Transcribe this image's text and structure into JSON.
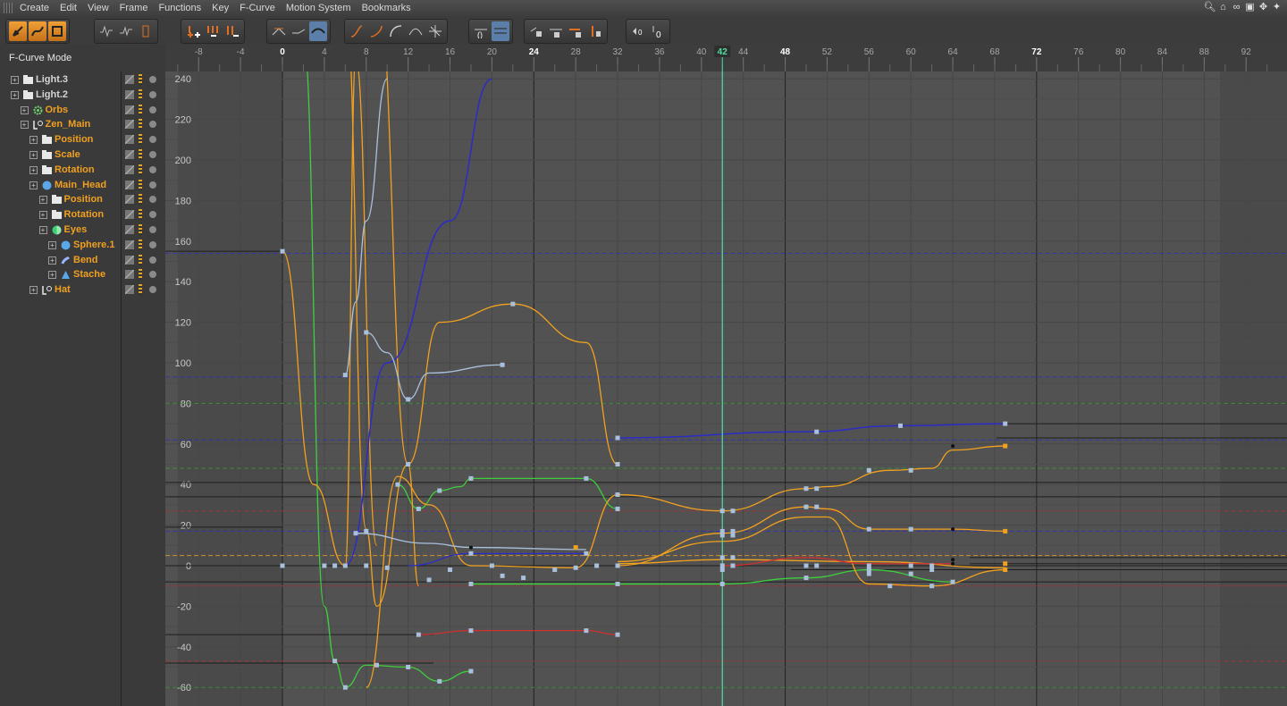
{
  "menubar": {
    "items": [
      "Create",
      "Edit",
      "View",
      "Frame",
      "Functions",
      "Key",
      "F-Curve",
      "Motion System",
      "Bookmarks"
    ]
  },
  "mode_label": "F-Curve Mode",
  "ruler": {
    "ticks": [
      "-8",
      "-4",
      "0",
      "4",
      "8",
      "12",
      "16",
      "20",
      "24",
      "28",
      "32",
      "36",
      "40",
      "44",
      "48",
      "52",
      "56",
      "60",
      "64",
      "68",
      "72",
      "76",
      "80",
      "84",
      "88",
      "92"
    ],
    "bold_ticks": [
      "0",
      "24",
      "48",
      "72"
    ],
    "current_frame": "42"
  },
  "y_axis": {
    "labels": [
      "240",
      "220",
      "200",
      "180",
      "160",
      "140",
      "120",
      "100",
      "80",
      "60",
      "40",
      "20",
      "0",
      "-20",
      "-40",
      "-60"
    ]
  },
  "tree": [
    {
      "label": "Light.3",
      "icon": "folder-icon",
      "level": 0,
      "color": "#d4d4d4"
    },
    {
      "label": "Light.2",
      "icon": "folder-icon",
      "level": 0,
      "color": "#d4d4d4"
    },
    {
      "label": "Orbs",
      "icon": "gear-icon",
      "level": 1,
      "color": "#f0a020"
    },
    {
      "label": "Zen_Main",
      "icon": "null-object-icon",
      "level": 1,
      "color": "#f0a020"
    },
    {
      "label": "Position",
      "icon": "folder-icon",
      "level": 2,
      "color": "#f0a020"
    },
    {
      "label": "Scale",
      "icon": "folder-icon",
      "level": 2,
      "color": "#f0a020"
    },
    {
      "label": "Rotation",
      "icon": "folder-icon",
      "level": 2,
      "color": "#f0a020"
    },
    {
      "label": "Main_Head",
      "icon": "sphere-icon",
      "level": 2,
      "color": "#f0a020"
    },
    {
      "label": "Position",
      "icon": "folder-icon",
      "level": 3,
      "color": "#f0a020"
    },
    {
      "label": "Rotation",
      "icon": "folder-icon",
      "level": 3,
      "color": "#f0a020"
    },
    {
      "label": "Eyes",
      "icon": "half-sphere-icon",
      "level": 3,
      "color": "#f0a020"
    },
    {
      "label": "Sphere.1",
      "icon": "sphere-icon",
      "level": 4,
      "color": "#f0a020"
    },
    {
      "label": "Bend",
      "icon": "bend-deformer-icon",
      "level": 4,
      "color": "#f0a020"
    },
    {
      "label": "Stache",
      "icon": "stache-icon",
      "level": 4,
      "color": "#f0a020"
    },
    {
      "label": "Hat",
      "icon": "null-object-icon",
      "level": 2,
      "color": "#f0a020"
    }
  ],
  "toolbar": {
    "icons": [
      "pointer-mode-icon",
      "fcurve-mode-icon",
      "dopesheet-mode-icon",
      "curve-view-icon-1",
      "curve-view-icon-2",
      "curve-view-icon-3",
      "add-key-icon",
      "add-keys-icon",
      "delete-key-icon",
      "flat-tangent-icon",
      "linear-tangent-icon",
      "smooth-tangent-icon",
      "ease-in-icon",
      "ease-out-icon",
      "ease-both-icon",
      "break-tangent-icon",
      "spline-icon",
      "zero-length-icon",
      "zero-angle-icon",
      "lock-key-icon",
      "lock-tangent-icon",
      "lock-value-icon",
      "lock-time-icon",
      "key-to-zero-icon",
      "zero-key-icon"
    ]
  },
  "colors": {
    "orange": "#f2a11f",
    "green": "#3ecf3e",
    "blue": "#2b2bc8",
    "light_blue": "#a9c0dc",
    "red": "#d03030",
    "playhead": "#4fe0a0"
  }
}
